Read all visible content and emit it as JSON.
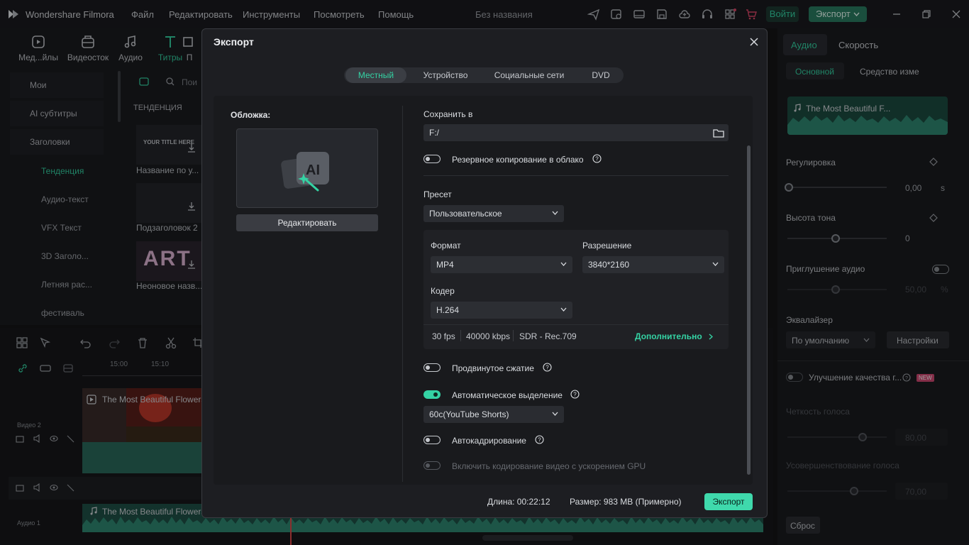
{
  "titlebar": {
    "app_title": "Wondershare Filmora",
    "menu": [
      "Файл",
      "Редактировать",
      "Инструменты",
      "Посмотреть",
      "Помощь"
    ],
    "doc_title": "Без названия",
    "login": "Войти",
    "export": "Экспорт"
  },
  "library": {
    "tabs": [
      "Мед...йлы",
      "Видеосток",
      "Аудио",
      "Титры",
      "П"
    ],
    "search_placeholder": "Пои",
    "section_header": "ТЕНДЕНЦИЯ",
    "categories": [
      "Мои",
      "AI субтитры",
      "Заголовки"
    ],
    "subcategories": [
      "Тенденция",
      "Аудио-текст",
      "VFX Текст",
      "3D Заголо...",
      "Летняя рас...",
      "фестиваль"
    ],
    "thumbs": [
      {
        "label": "Название по у...",
        "overlay": "YOUR TITLE HERE"
      },
      {
        "label": "Подзаголовок 2",
        "overlay": ""
      },
      {
        "label": "Неоновое назв...",
        "overlay": "ART"
      }
    ]
  },
  "timeline": {
    "ruler": [
      "15:00",
      "15:10"
    ],
    "track_video": "Видео 2",
    "track_audio": "Аудио 1",
    "video_clip_title": "The Most Beautiful Flowers",
    "audio_clip_title": "The Most Beautiful Flowers"
  },
  "right_panel": {
    "tabs": [
      "Аудио",
      "Скорость"
    ],
    "subtabs": [
      "Основной",
      "Средство изме"
    ],
    "clip_title": "The Most Beautiful F...",
    "adjust": "Регулировка",
    "adjust_value": "0,00",
    "adjust_unit": "s",
    "pitch": "Высота тона",
    "pitch_value": "0",
    "mute": "Приглушение аудио",
    "mute_value": "50,00",
    "mute_unit": "%",
    "eq": "Эквалайзер",
    "eq_value": "По умолчанию",
    "eq_settings": "Настройки",
    "quality": "Улучшение качества г...",
    "badge_new": "NEW",
    "clarity": "Четкость голоса",
    "clarity_value": "80,00",
    "voice_improve": "Усовершенствование голоса",
    "voice_value": "70,00",
    "reset": "Сброс"
  },
  "dialog": {
    "title": "Экспорт",
    "tabs": [
      "Местный",
      "Устройство",
      "Социальные сети",
      "DVD"
    ],
    "cover_label": "Обложка:",
    "cover_ai": "AI",
    "edit_button": "Редактировать",
    "save_to_label": "Сохранить в",
    "save_path": "F:/",
    "cloud_backup": "Резервное копирование в облако",
    "preset_label": "Пресет",
    "preset_value": "Пользовательское",
    "format_label": "Формат",
    "format_value": "MP4",
    "resolution_label": "Разрешение",
    "resolution_value": "3840*2160",
    "encoder_label": "Кодер",
    "encoder_value": "H.264",
    "fps": "30 fps",
    "bitrate": "40000 kbps",
    "color": "SDR - Rec.709",
    "more": "Дополнительно",
    "advanced_compress": "Продвинутое сжатие",
    "auto_highlight": "Автоматическое выделение",
    "highlight_value": "60с(YouTube Shorts)",
    "auto_reframe": "Автокадрирование",
    "gpu_encode": "Включить кодирование видео с ускорением GPU",
    "duration": "Длина: 00:22:12",
    "size": "Размер: 983 MB (Примерно)",
    "export_button": "Экспорт"
  },
  "colors": {
    "accent": "#34d3a4",
    "export_btn": "#3fd9ac",
    "dialog_bg": "#1d1e22"
  },
  "toggles": {
    "cloud_backup": false,
    "advanced_compress": false,
    "auto_highlight": true,
    "auto_reframe": false,
    "gpu_encode": false
  }
}
